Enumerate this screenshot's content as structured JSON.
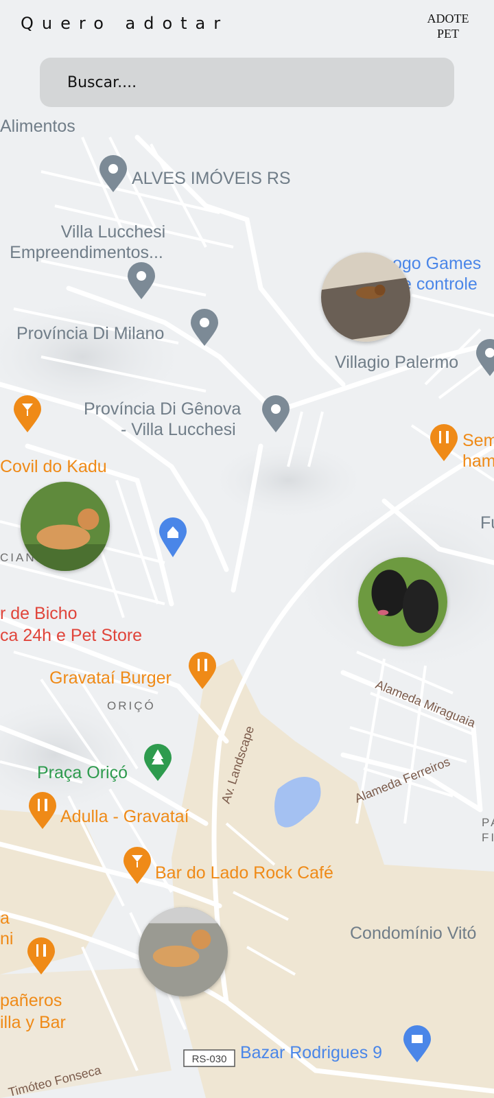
{
  "header": {
    "title": "Quero adotar",
    "brand_line1": "ADOTE",
    "brand_line2": "PET"
  },
  "search": {
    "placeholder": "Buscar...."
  },
  "map": {
    "poi_gray": [
      "Alimentos",
      "ALVES IMÓVEIS RS",
      "Villa Lucchesi",
      "Empreendimentos...",
      "Província Di Milano",
      "Província Di Gênova",
      "- Villa Lucchesi",
      "Villagio Palermo",
      "ORIÇÓ",
      "CIANO",
      "Condomínio Vitó",
      "Fu",
      "PA",
      "FI"
    ],
    "poi_orange": [
      "Covil do Kadu",
      "Gravataí Burger",
      "Adulla - Gravataí",
      "Bar do Lado Rock Café",
      "Sem",
      "ham",
      "pañeros",
      "illa y Bar",
      "a",
      "ni"
    ],
    "poi_blue": [
      "ogo Games",
      "e controle",
      "Bazar Rodrigues 9"
    ],
    "poi_red": [
      "r de Bicho",
      "ca 24h e Pet Store"
    ],
    "poi_green": [
      "Praça Oriçó"
    ],
    "streets": [
      "Alameda Miraguaia",
      "Alameda Ferreiros",
      "Av. Landscape",
      "Timóteo Fonseca"
    ],
    "route_shield": "RS-030"
  },
  "pets": [
    {
      "name": "dog-brown-on-rug"
    },
    {
      "name": "cat-orange-on-grass"
    },
    {
      "name": "dogs-black-pair"
    },
    {
      "name": "cat-orange-on-stones"
    }
  ],
  "colors": {
    "poi_gray": "#707d88",
    "poi_orange": "#ef8a17",
    "poi_blue": "#4a86e8",
    "poi_red": "#e0443a",
    "poi_green": "#2e9b4e"
  }
}
